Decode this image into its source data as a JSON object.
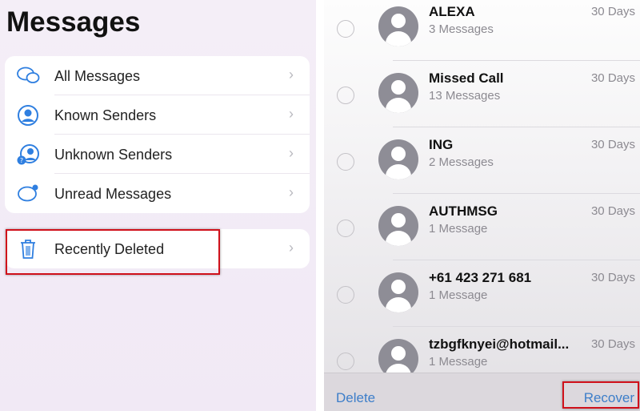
{
  "left": {
    "title": "Messages",
    "filters": [
      {
        "label": "All Messages",
        "icon": "chat-bubbles-icon"
      },
      {
        "label": "Known Senders",
        "icon": "person-circle-icon"
      },
      {
        "label": "Unknown Senders",
        "icon": "unknown-person-icon"
      },
      {
        "label": "Unread Messages",
        "icon": "unread-bubble-icon"
      }
    ],
    "recently_deleted": {
      "label": "Recently Deleted",
      "icon": "trash-icon"
    }
  },
  "right": {
    "items": [
      {
        "name": "ALEXA",
        "count": "3 Messages",
        "days": "30 Days"
      },
      {
        "name": "Missed Call",
        "count": "13 Messages",
        "days": "30 Days"
      },
      {
        "name": "ING",
        "count": "2 Messages",
        "days": "30 Days"
      },
      {
        "name": "AUTHMSG",
        "count": "1 Message",
        "days": "30 Days"
      },
      {
        "name": "+61 423 271 681",
        "count": "1 Message",
        "days": "30 Days"
      },
      {
        "name": "tzbgfknyei@hotmail...",
        "count": "1 Message",
        "days": "30 Days"
      }
    ],
    "delete_label": "Delete",
    "recover_label": "Recover"
  },
  "colors": {
    "accent": "#2f7fe0",
    "highlight": "#d0111b"
  }
}
